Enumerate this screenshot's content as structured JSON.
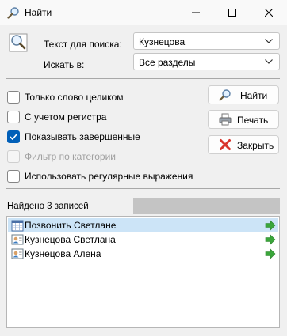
{
  "window": {
    "title": "Найти"
  },
  "search": {
    "text_label": "Текст для поиска:",
    "text_value": "Кузнецова",
    "scope_label": "Искать в:",
    "scope_value": "Все разделы"
  },
  "options": [
    {
      "label": "Только слово целиком",
      "checked": false,
      "disabled": false
    },
    {
      "label": "С учетом регистра",
      "checked": false,
      "disabled": false
    },
    {
      "label": "Показывать завершенные",
      "checked": true,
      "disabled": false
    },
    {
      "label": "Фильтр по категории",
      "checked": false,
      "disabled": true
    },
    {
      "label": "Использовать регулярные выражения",
      "checked": false,
      "disabled": false
    }
  ],
  "buttons": {
    "find": "Найти",
    "print": "Печать",
    "close": "Закрыть"
  },
  "results": {
    "count_label": "Найдено 3 записей",
    "items": [
      {
        "text": "Позвонить Светлане",
        "icon": "calendar-icon",
        "selected": true
      },
      {
        "text": "Кузнецова Светлана",
        "icon": "contact-card-icon",
        "selected": false
      },
      {
        "text": "Кузнецова Алена",
        "icon": "contact-card-icon",
        "selected": false
      }
    ]
  },
  "colors": {
    "accent": "#005fb8",
    "selection": "#cce4f7",
    "go_arrow": "#3aa63a"
  }
}
